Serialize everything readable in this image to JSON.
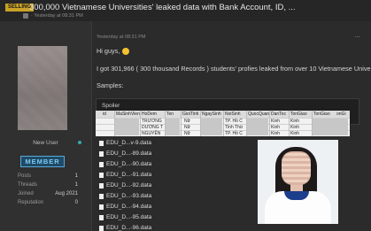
{
  "thread": {
    "badge": "SELLING",
    "title": "300,000 Vietnamese Universities' leaked data with Bank Account, ID, ...",
    "subtitle": "· Yesterday at 08:31 PM"
  },
  "user": {
    "name": "New User",
    "role": "MEMBER",
    "stats": [
      {
        "label": "Posts",
        "value": "1"
      },
      {
        "label": "Threads",
        "value": "1"
      },
      {
        "label": "Joined",
        "value": "Aug 2021"
      },
      {
        "label": "Reputation",
        "value": "0"
      }
    ]
  },
  "post": {
    "date": "Yesterday at 08:31 PM",
    "greeting": "Hi guys,",
    "body": "I got 301,966 ( 300 thousand Records ) students' profies leaked from over 10 Vietnamese Universities",
    "samples": "Samples:",
    "spoiler": "Spoiler"
  },
  "table": {
    "headers": [
      "id",
      "MaSinhVien",
      "HoDem",
      "Ten",
      "GioiTinh",
      "NgaySinh",
      "NoiSinh",
      "QuocQuan",
      "DanToc",
      "TonGiao",
      "TonGiao",
      "onGi"
    ],
    "rows": [
      [
        "",
        "",
        "TRƯƠNG",
        "",
        "Nữ",
        "",
        "TP. Hồ C",
        "",
        "Kinh",
        "Kinh"
      ],
      [
        "",
        "",
        "DƯƠNG T",
        "",
        "Nữ",
        "",
        "Tỉnh Thừ",
        "",
        "Kinh",
        "Kinh"
      ],
      [
        "",
        "",
        "NGUYỄN",
        "",
        "Nữ",
        "",
        "TP. Hồ C",
        "",
        "Kinh",
        "Kinh"
      ]
    ]
  },
  "files": [
    "EDU_D...v-9.data",
    "EDU_D...-89.data",
    "EDU_D...-90.data",
    "EDU_D...-91.data",
    "EDU_D...-92.data",
    "EDU_D...-93.data",
    "EDU_D...-94.data",
    "EDU_D...-95.data",
    "EDU_D...-96.data"
  ],
  "colors": {
    "badge": "#c9a227",
    "role": "#7ec8f4",
    "background": "#2b2b2b"
  }
}
